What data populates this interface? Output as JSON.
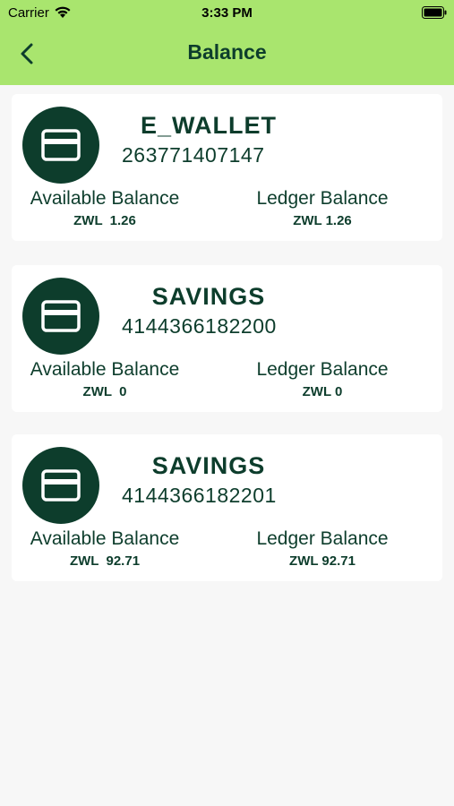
{
  "status_bar": {
    "carrier": "Carrier",
    "time": "3:33 PM"
  },
  "header": {
    "title": "Balance",
    "back_icon": "chevron-left-icon"
  },
  "accounts": [
    {
      "name": "E_WALLET",
      "number": "263771407147",
      "available_label": "Available Balance",
      "available_value": "ZWL  1.26",
      "ledger_label": "Ledger Balance",
      "ledger_value": "ZWL 1.26",
      "icon": "credit-card-icon"
    },
    {
      "name": "SAVINGS",
      "number": "4144366182200",
      "available_label": "Available Balance",
      "available_value": "ZWL  0",
      "ledger_label": "Ledger Balance",
      "ledger_value": "ZWL 0",
      "icon": "credit-card-icon"
    },
    {
      "name": "SAVINGS",
      "number": "4144366182201",
      "available_label": "Available Balance",
      "available_value": "ZWL  92.71",
      "ledger_label": "Ledger Balance",
      "ledger_value": "ZWL 92.71",
      "icon": "credit-card-icon"
    }
  ],
  "colors": {
    "header_bg": "#a9e56e",
    "accent": "#0d3d2c",
    "card_bg": "#ffffff",
    "page_bg": "#f7f7f7"
  }
}
